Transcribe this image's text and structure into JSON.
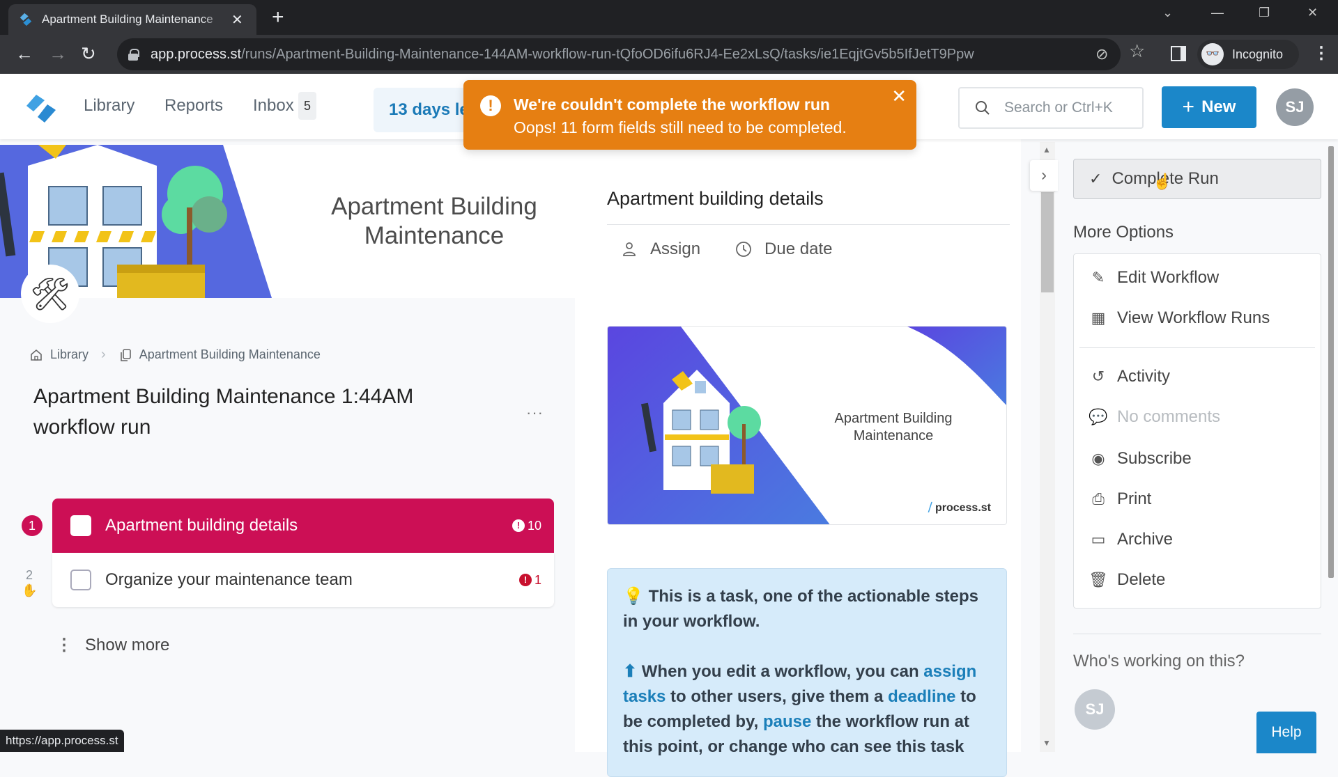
{
  "browser": {
    "tab_title": "Apartment Building Maintenance",
    "tab_close": "✕",
    "new_tab": "+",
    "url_host": "app.process.st",
    "url_path": "/runs/Apartment-Building-Maintenance-144AM-workflow-run-tQfoOD6ifu6RJ4-Ee2xLsQ/tasks/ie1EqjtGv5b5IfJetT9Ppw",
    "profile_label": "Incognito",
    "status_url": "https://app.process.st",
    "icons": {
      "back": "←",
      "forward": "→",
      "reload": "↻",
      "eye_off": "⊘",
      "star": "☆",
      "menu": "⋮",
      "minimize": "—",
      "restore": "❐",
      "close": "✕",
      "dropdown": "⌄"
    }
  },
  "header": {
    "nav": [
      {
        "label": "Library"
      },
      {
        "label": "Reports"
      },
      {
        "label": "Inbox"
      }
    ],
    "inbox_count": "5",
    "trial_banner": "13 days left",
    "search_placeholder": "Search or Ctrl+K",
    "new_button": "New",
    "new_plus": "+",
    "user_initials": "SJ"
  },
  "toast": {
    "icon": "!",
    "title": "We're couldn't complete the workflow run",
    "message": "Oops! 11 form fields still need to be completed.",
    "close": "✕",
    "color": "#e67f12"
  },
  "run": {
    "hero_title_line1": "Apartment Building",
    "hero_title_line2": "Maintenance",
    "breadcrumb": [
      {
        "label": "Library"
      },
      {
        "label": "Apartment Building Maintenance"
      }
    ],
    "breadcrumb_sep": "›",
    "title": "Apartment Building Maintenance 1:44AM workflow run",
    "more_menu": "···",
    "tasks": [
      {
        "number": "1",
        "label": "Apartment building details",
        "error_count": "10",
        "active": true
      },
      {
        "number": "2",
        "label": "Organize your maintenance team",
        "error_count": "1",
        "active": false
      }
    ],
    "show_more": "Show more",
    "accent_color": "#cc0f55"
  },
  "task_detail": {
    "heading": "Apartment building details",
    "assign": "Assign",
    "due_date": "Due date",
    "cover_title_line1": "Apartment Building",
    "cover_title_line2": "Maintenance",
    "cover_brand": "process.st",
    "info": {
      "p1": "This is a task, one of the actionable steps in your workflow.",
      "p2_a": "When you edit a workflow, you can ",
      "p2_link1": "assign tasks",
      "p2_b": " to other users, give them a ",
      "p2_link2": "deadline",
      "p2_c": " to be completed by, ",
      "p2_link3": "pause",
      "p2_d": " the workflow run at this point, or change who can see this task"
    }
  },
  "sidebar": {
    "complete_run": "Complete Run",
    "more_options": "More Options",
    "options": [
      {
        "label": "Edit Workflow",
        "icon": "pencil",
        "disabled": false
      },
      {
        "label": "View Workflow Runs",
        "icon": "table",
        "disabled": false
      },
      {
        "label": "Activity",
        "icon": "history",
        "disabled": false
      },
      {
        "label": "No comments",
        "icon": "comment",
        "disabled": true
      },
      {
        "label": "Subscribe",
        "icon": "eye",
        "disabled": false
      },
      {
        "label": "Print",
        "icon": "printer",
        "disabled": false
      },
      {
        "label": "Archive",
        "icon": "archive",
        "disabled": false
      },
      {
        "label": "Delete",
        "icon": "trash",
        "disabled": false
      }
    ],
    "who_working": "Who's working on this?",
    "worker_initials": "SJ",
    "help": "Help"
  }
}
